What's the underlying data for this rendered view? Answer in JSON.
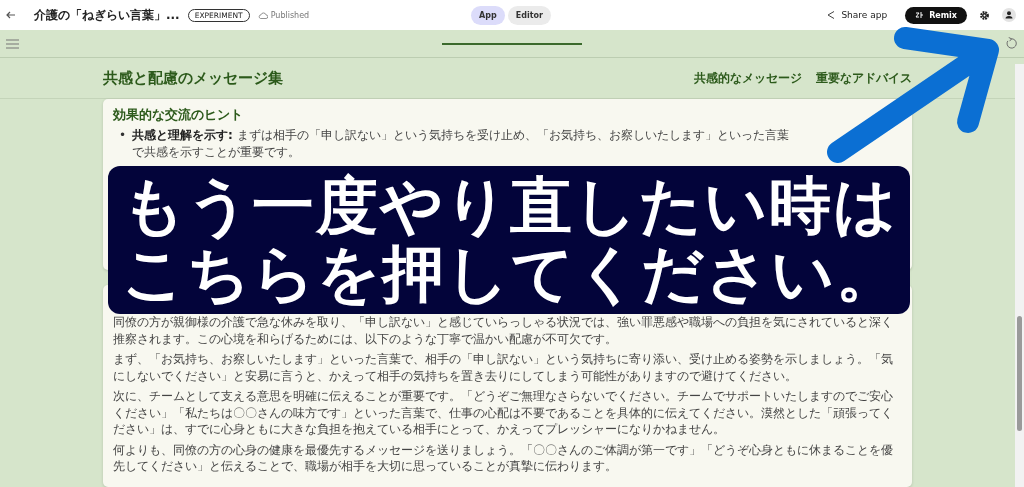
{
  "topbar": {
    "title": "介護の「ねぎらい言葉」...",
    "badge": "EXPERIMENT",
    "status": "Published",
    "tabs": [
      {
        "label": "App",
        "selected": true
      },
      {
        "label": "Editor",
        "selected": false
      }
    ],
    "share": "Share app",
    "remix": "Remix"
  },
  "header": {
    "title": "共感と配慮のメッセージ集",
    "nav": [
      "共感的なメッセージ",
      "重要なアドバイス"
    ]
  },
  "cards": [
    {
      "heading": "効果的な交流のヒント",
      "marker": "•",
      "bullets": [
        "**共感と理解を示す:** まずは相手の「申し訳ない」という気持ちを受け止め、「お気持ち、お察しいたします」といった言葉で共感を示すことが重要です。"
      ]
    },
    {
      "paragraphs": [
        "同僚の方が親御様の介護で急な休みを取り、「申し訳ない」と感じていらっしゃる状況では、強い罪悪感や職場への負担を気にされていると深く推察されます。この心境を和らげるためには、以下のような丁寧で温かい配慮が不可欠です。",
        "まず、「お気持ち、お察しいたします」といった言葉で、相手の「申し訳ない」という気持ちに寄り添い、受け止める姿勢を示しましょう。「気にしないでください」と安易に言うと、かえって相手の気持ちを置き去りにしてしまう可能性がありますので避けてください。",
        "次に、チームとして支える意思を明確に伝えることが重要です。「どうぞご無理なさらないでください。チームでサポートいたしますのでご安心ください」「私たちは〇〇さんの味方です」といった言葉で、仕事の心配は不要であることを具体的に伝えてください。漠然とした「頑張ってください」は、すでに心身ともに大きな負担を抱えている相手にとって、かえってプレッシャーになりかねません。",
        "何よりも、同僚の方の心身の健康を最優先するメッセージを送りましょう。「〇〇さんのご体調が第一です」「どうぞ心身ともに休まることを優先してください」と伝えることで、職場が相手を大切に思っていることが真摯に伝わります。"
      ]
    }
  ],
  "callout": {
    "lines": [
      "もう一度やり直したい時は",
      "こちらを押してください。"
    ]
  }
}
